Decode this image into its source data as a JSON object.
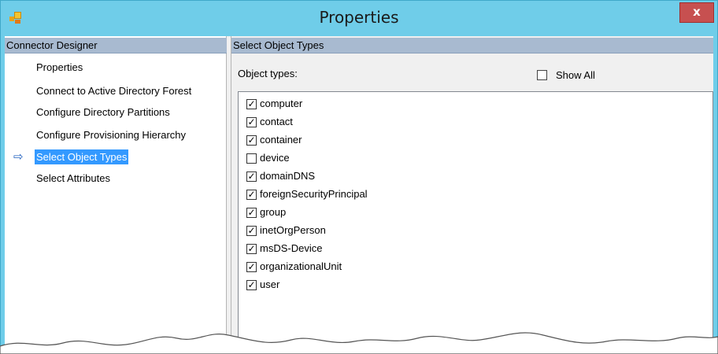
{
  "window": {
    "title": "Properties",
    "close_label": "x",
    "accent": "#6fcde9",
    "close_color": "#c75050"
  },
  "left_pane": {
    "header": "Connector Designer",
    "items": [
      {
        "label": "Properties",
        "selected": false
      },
      {
        "label": "Connect to Active Directory Forest",
        "selected": false
      },
      {
        "label": "Configure Directory Partitions",
        "selected": false
      },
      {
        "label": "Configure Provisioning Hierarchy",
        "selected": false
      },
      {
        "label": "Select Object Types",
        "selected": true
      },
      {
        "label": "Select Attributes",
        "selected": false
      }
    ],
    "selected_arrow_icon": "right-arrow-icon"
  },
  "right_pane": {
    "header": "Select Object Types",
    "object_types_label": "Object types:",
    "show_all": {
      "label": "Show All",
      "checked": false
    },
    "object_types": [
      {
        "name": "computer",
        "checked": true
      },
      {
        "name": "contact",
        "checked": true
      },
      {
        "name": "container",
        "checked": true
      },
      {
        "name": "device",
        "checked": false
      },
      {
        "name": "domainDNS",
        "checked": true
      },
      {
        "name": "foreignSecurityPrincipal",
        "checked": true
      },
      {
        "name": "group",
        "checked": true
      },
      {
        "name": "inetOrgPerson",
        "checked": true
      },
      {
        "name": "msDS-Device",
        "checked": true
      },
      {
        "name": "organizationalUnit",
        "checked": true
      },
      {
        "name": "user",
        "checked": true
      }
    ]
  },
  "colors": {
    "selection": "#3399ff",
    "pane_header": "#a8bad0"
  }
}
